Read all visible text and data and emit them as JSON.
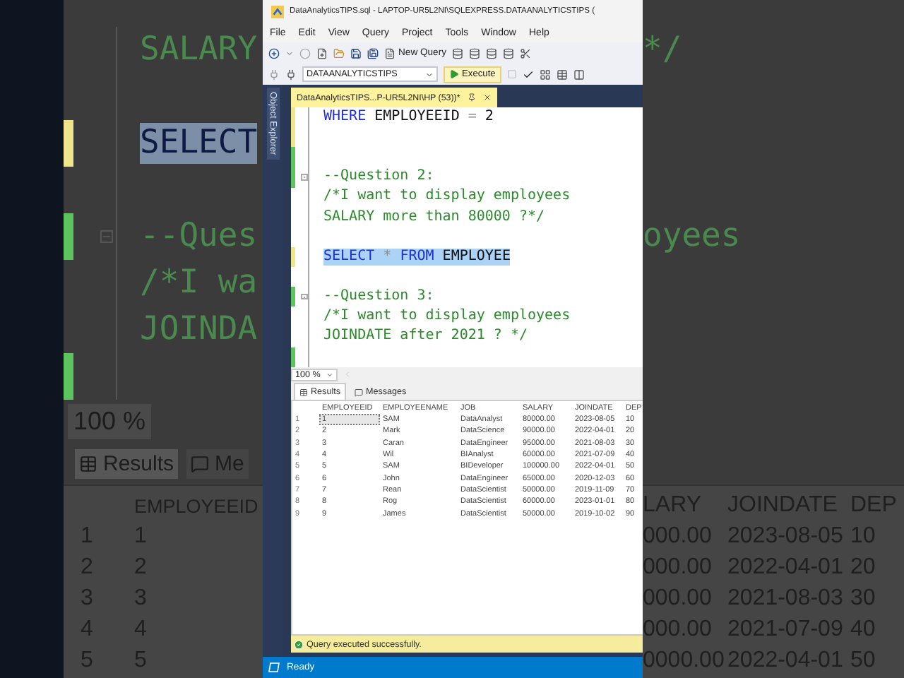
{
  "backdrop": {
    "left": {
      "lines": [
        {
          "kind": "code",
          "selected": false,
          "tokens": [
            {
              "kind": "comment",
              "text": "SALARY"
            }
          ]
        },
        {
          "kind": "blank"
        },
        {
          "kind": "code",
          "color": "#efe58b",
          "selected": true,
          "tokens": [
            {
              "kind": "keyword",
              "text": "SELECT"
            }
          ]
        },
        {
          "kind": "blank"
        },
        {
          "kind": "region",
          "color": "#5cc45c",
          "selected": false,
          "tokens": [
            {
              "kind": "comment",
              "text": "--Ques"
            }
          ]
        },
        {
          "kind": "code",
          "selected": false,
          "tokens": [
            {
              "kind": "comment",
              "text": "/*I wa"
            }
          ]
        },
        {
          "kind": "code",
          "selected": false,
          "tokens": [
            {
              "kind": "comment",
              "text": "JOINDA"
            }
          ]
        },
        {
          "kind": "blank",
          "color": "#5cc45c"
        }
      ],
      "zoom": "100 %",
      "tabs": [
        {
          "label": "Results",
          "selected": true
        },
        {
          "label": "Me",
          "selected": false
        }
      ],
      "header": "EMPLOYEEID",
      "rows": [
        [
          "1",
          "1"
        ],
        [
          "2",
          "2"
        ],
        [
          "3",
          "3"
        ],
        [
          "4",
          "4"
        ],
        [
          "5",
          "5"
        ]
      ]
    },
    "right": {
      "lines": [
        {
          "kind": "code",
          "selected": false,
          "tokens": [
            {
              "kind": "comment",
              "text": "*/"
            }
          ]
        },
        {
          "kind": "blank"
        },
        {
          "kind": "blank"
        },
        {
          "kind": "blank"
        },
        {
          "kind": "code",
          "selected": false,
          "tokens": [
            {
              "kind": "comment",
              "text": "oyees"
            }
          ]
        }
      ],
      "headers": [
        "LARY",
        "JOINDATE",
        "DEP"
      ],
      "rows": [
        [
          "000.00",
          "2023-08-05",
          "10"
        ],
        [
          "000.00",
          "2022-04-01",
          "20"
        ],
        [
          "000.00",
          "2021-08-03",
          "30"
        ],
        [
          "000.00",
          "2021-07-09",
          "40"
        ],
        [
          "0000.00",
          "2022-04-01",
          "50"
        ]
      ]
    }
  },
  "window": {
    "title": "DataAnalyticsTIPS.sql - LAPTOP-UR5L2NI\\SQLEXPRESS.DATAANALYTICSTIPS (",
    "menu": [
      "File",
      "Edit",
      "View",
      "Query",
      "Project",
      "Tools",
      "Window",
      "Help"
    ],
    "toolbar": {
      "new_query": "New Query",
      "database": "DATAANALYTICSTIPS",
      "execute": "Execute"
    },
    "side_tab": "Object Explorer",
    "document_tab": "DataAnalyticsTIPS...P-UR5L2NI\\HP (53))*",
    "editor": {
      "lines": [
        {
          "kind": "code",
          "color": "#efe58b",
          "selected": false,
          "tokens": [
            {
              "kind": "keyword",
              "text": "WHERE"
            },
            {
              "kind": "plain",
              "text": " EMPLOYEEID "
            },
            {
              "kind": "operator",
              "text": "="
            },
            {
              "kind": "plain",
              "text": " 2"
            }
          ]
        },
        {
          "kind": "blank",
          "color": "#efe58b"
        },
        {
          "kind": "blank",
          "color": "#5cc45c"
        },
        {
          "kind": "region",
          "color": "#5cc45c",
          "selected": false,
          "tokens": [
            {
              "kind": "comment",
              "text": "--Question 2:"
            }
          ]
        },
        {
          "kind": "code",
          "selected": false,
          "tokens": [
            {
              "kind": "comment",
              "text": "/*I want to display employees"
            }
          ]
        },
        {
          "kind": "code",
          "selected": false,
          "tokens": [
            {
              "kind": "comment",
              "text": "SALARY more than 80000 ?*/"
            }
          ]
        },
        {
          "kind": "blank"
        },
        {
          "kind": "code",
          "color": "#efe58b",
          "selected": true,
          "tokens": [
            {
              "kind": "keyword",
              "text": "SELECT"
            },
            {
              "kind": "operator",
              "text": " * "
            },
            {
              "kind": "keyword",
              "text": "FROM"
            },
            {
              "kind": "plain",
              "text": " EMPLOYEE"
            }
          ]
        },
        {
          "kind": "blank"
        },
        {
          "kind": "region",
          "color": "#5cc45c",
          "selected": false,
          "tokens": [
            {
              "kind": "comment",
              "text": "--Question 3:"
            }
          ]
        },
        {
          "kind": "code",
          "selected": false,
          "tokens": [
            {
              "kind": "comment",
              "text": "/*I want to display employees"
            }
          ]
        },
        {
          "kind": "code",
          "selected": false,
          "tokens": [
            {
              "kind": "comment",
              "text": "JOINDATE after 2021 ? */"
            }
          ]
        },
        {
          "kind": "blank",
          "color": "#5cc45c"
        }
      ]
    },
    "zoom": "100 %",
    "result_tabs": [
      {
        "label": "Results",
        "selected": true
      },
      {
        "label": "Messages",
        "selected": false
      }
    ],
    "grid": {
      "columns": [
        "",
        "EMPLOYEEID",
        "EMPLOYEENAME",
        "JOB",
        "SALARY",
        "JOINDATE",
        "DEP"
      ],
      "rows": [
        {
          "selected": true,
          "cells": [
            "1",
            "1",
            "SAM",
            "DataAnalyst",
            "80000.00",
            "2023-08-05",
            "10"
          ]
        },
        {
          "selected": false,
          "cells": [
            "2",
            "2",
            "Mark",
            "DataScience",
            "90000.00",
            "2022-04-01",
            "20"
          ]
        },
        {
          "selected": false,
          "cells": [
            "3",
            "3",
            "Caran",
            "DataEngineer",
            "95000.00",
            "2021-08-03",
            "30"
          ]
        },
        {
          "selected": false,
          "cells": [
            "4",
            "4",
            "Wil",
            "BIAnalyst",
            "60000.00",
            "2021-07-09",
            "40"
          ]
        },
        {
          "selected": false,
          "cells": [
            "5",
            "5",
            "SAM",
            "BIDeveloper",
            "100000.00",
            "2022-04-01",
            "50"
          ]
        },
        {
          "selected": false,
          "cells": [
            "6",
            "6",
            "John",
            "DataEngineer",
            "65000.00",
            "2020-12-03",
            "60"
          ]
        },
        {
          "selected": false,
          "cells": [
            "7",
            "7",
            "Rean",
            "DataScientist",
            "50000.00",
            "2019-11-09",
            "70"
          ]
        },
        {
          "selected": false,
          "cells": [
            "8",
            "8",
            "Rog",
            "DataScientist",
            "60000.00",
            "2023-01-01",
            "80"
          ]
        },
        {
          "selected": false,
          "cells": [
            "9",
            "9",
            "James",
            "DataScientist",
            "50000.00",
            "2019-10-02",
            "90"
          ]
        }
      ]
    },
    "query_status": "Query executed successfully.",
    "status_bar": "Ready"
  }
}
